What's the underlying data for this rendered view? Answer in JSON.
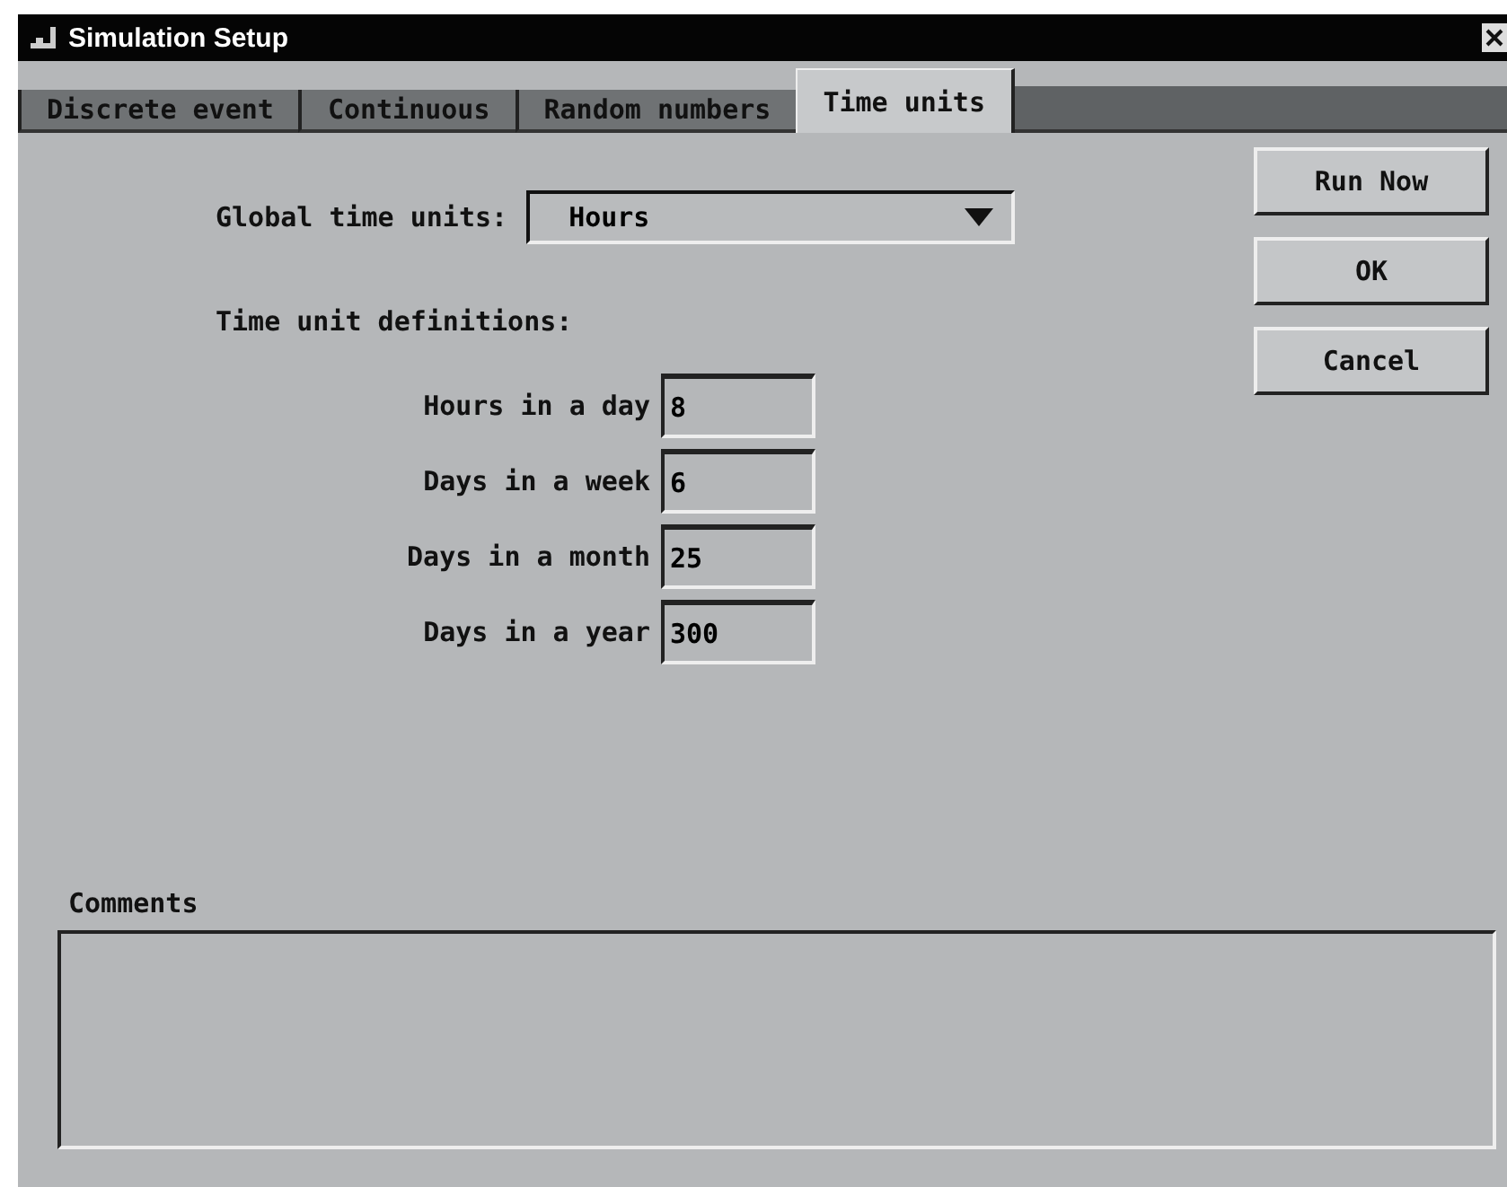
{
  "window": {
    "title": "Simulation Setup"
  },
  "tabs": [
    {
      "label": "Discrete event",
      "selected": false
    },
    {
      "label": "Continuous",
      "selected": false
    },
    {
      "label": "Random numbers",
      "selected": false
    },
    {
      "label": "Time units",
      "selected": true
    }
  ],
  "global_time_units": {
    "label": "Global time units:",
    "value": "Hours"
  },
  "definitions_heading": "Time unit definitions:",
  "definitions": [
    {
      "label": "Hours in a day",
      "value": "8"
    },
    {
      "label": "Days in a week",
      "value": "6"
    },
    {
      "label": "Days in a month",
      "value": "25"
    },
    {
      "label": "Days in a year",
      "value": "300"
    }
  ],
  "buttons": [
    "Run Now",
    "OK",
    "Cancel"
  ],
  "comments": {
    "label": "Comments"
  }
}
